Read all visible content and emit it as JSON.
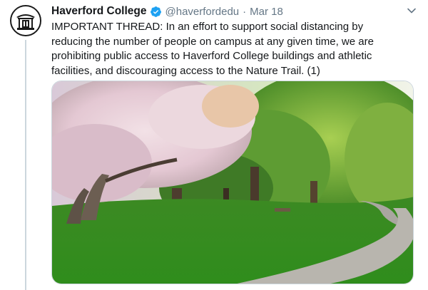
{
  "tweet": {
    "display_name": "Haverford College",
    "handle": "@haverfordedu",
    "separator": "·",
    "date": "Mar 18",
    "text": "IMPORTANT THREAD: In an effort to support social distancing by\nreducing the number of people on campus at any given time, we are\nprohibiting public access to Haverford College buildings and athletic\nfacilities, and discouraging access to the Nature Trail. (1)"
  },
  "icons": {
    "avatar": "college-building-logo",
    "verified": "verified-badge-icon",
    "menu": "chevron-down-icon"
  },
  "colors": {
    "verified_blue": "#1da1f2",
    "secondary_text": "#657786",
    "thread_line": "#ccd6dd"
  }
}
